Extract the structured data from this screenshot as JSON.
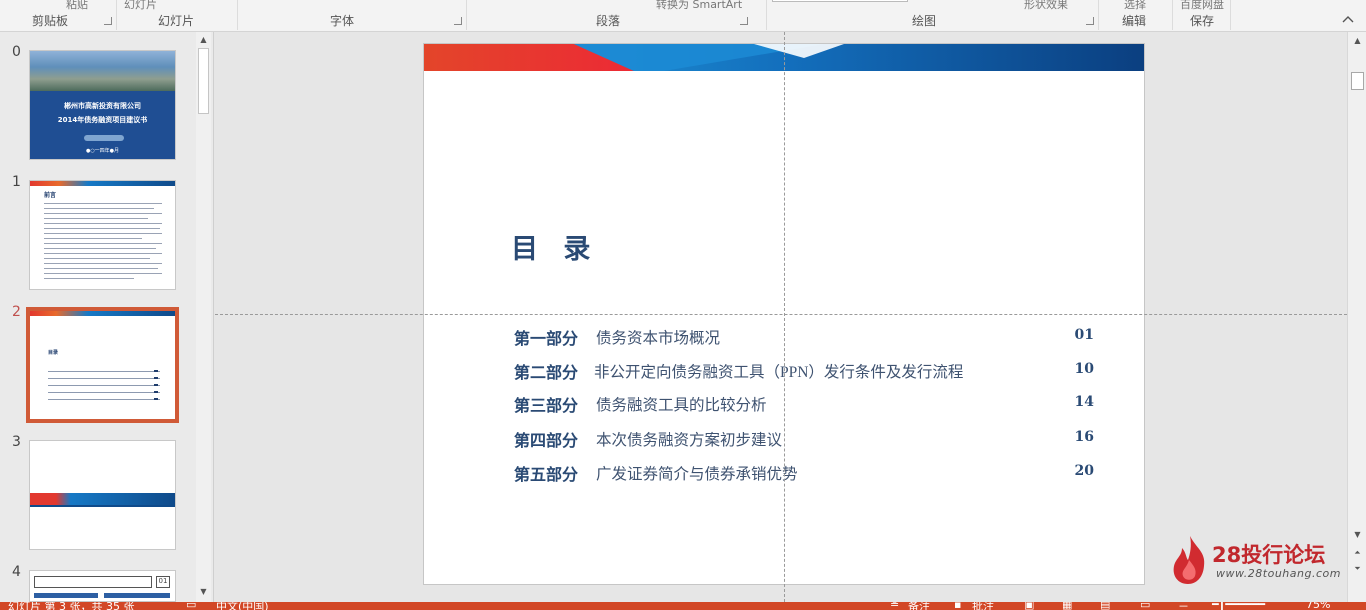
{
  "ribbon": {
    "cutoff": {
      "paste": "粘贴",
      "new_slide": "幻灯片",
      "arrange": "转换为 SmartArt",
      "quick_styles": "形状效果",
      "select": "选择",
      "baidu": "百度网盘"
    },
    "groups": {
      "clipboard": "剪贴板",
      "slides": "幻灯片",
      "font": "字体",
      "paragraph": "段落",
      "drawing": "绘图",
      "editing": "编辑",
      "save": "保存"
    },
    "collapse_icon": "chevron-up-icon"
  },
  "thumbnails": {
    "numbers": [
      "0",
      "1",
      "2",
      "3",
      "4"
    ],
    "active_index": 2,
    "slide0": {
      "line1": "郴州市高新投资有限公司",
      "line2": "2014年债务融资项目建议书",
      "date": "●○一四年●月"
    },
    "slide1": {
      "heading": "前言"
    },
    "slide2": {
      "heading": "目录"
    },
    "slide4": {
      "box_number": "01"
    }
  },
  "slide": {
    "title": "目 录",
    "toc": [
      {
        "part": "第一部分",
        "text": "债务资本市场概况",
        "page": "01"
      },
      {
        "part": "第二部分",
        "text": "非公开定向债务融资工具（PPN）发行条件及发行流程",
        "page": "10"
      },
      {
        "part": "第三部分",
        "text": "债务融资工具的比较分析",
        "page": "14"
      },
      {
        "part": "第四部分",
        "text": "本次债务融资方案初步建议",
        "page": "16"
      },
      {
        "part": "第五部分",
        "text": "广发证券简介与债券承销优势",
        "page": "20"
      }
    ],
    "colors": {
      "red": "#e2382f",
      "blue": "#1679c6",
      "navy": "#0f4a8a",
      "title": "#2a4a74"
    }
  },
  "watermark": {
    "brand": "28投行论坛",
    "url": "www.28touhang.com",
    "icon": "flame-logo-icon"
  },
  "statusbar": {
    "slide_info": "幻灯片 第 3 张，共 35 张",
    "language": "中文(中国)",
    "notes": "备注",
    "comments": "批注",
    "zoom": "75%"
  }
}
